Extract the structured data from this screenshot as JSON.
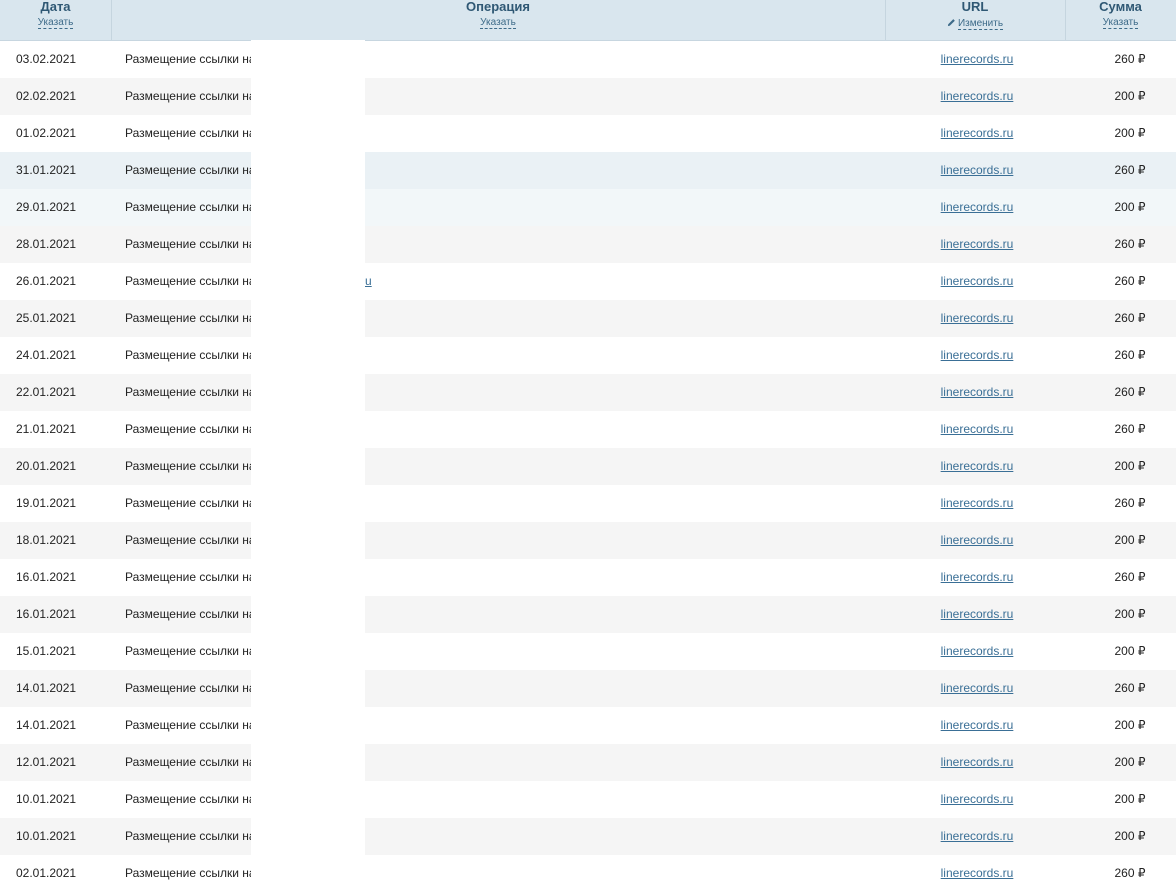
{
  "header": {
    "date": {
      "title": "Дата",
      "sub": "Указать"
    },
    "operation": {
      "title": "Операция",
      "sub": "Указать"
    },
    "url": {
      "title": "URL",
      "sub": "Изменить",
      "icon": "pencil-icon"
    },
    "sum": {
      "title": "Сумма",
      "sub": "Указать"
    }
  },
  "rows": [
    {
      "date": "03.02.2021",
      "op": "Размещение ссылки на",
      "url": "linerecords.ru",
      "sum": "260 ₽"
    },
    {
      "date": "02.02.2021",
      "op": "Размещение ссылки на",
      "url": "linerecords.ru",
      "sum": "200 ₽"
    },
    {
      "date": "01.02.2021",
      "op": "Размещение ссылки на",
      "url": "linerecords.ru",
      "sum": "200 ₽"
    },
    {
      "date": "31.01.2021",
      "op": "Размещение ссылки на",
      "url": "linerecords.ru",
      "sum": "260 ₽"
    },
    {
      "date": "29.01.2021",
      "op": "Размещение ссылки на",
      "url": "linerecords.ru",
      "sum": "200 ₽"
    },
    {
      "date": "28.01.2021",
      "op": "Размещение ссылки на",
      "url": "linerecords.ru",
      "sum": "260 ₽"
    },
    {
      "date": "26.01.2021",
      "op": "Размещение ссылки на",
      "url": "linerecords.ru",
      "sum": "260 ₽",
      "stray": "u"
    },
    {
      "date": "25.01.2021",
      "op": "Размещение ссылки на",
      "url": "linerecords.ru",
      "sum": "260 ₽"
    },
    {
      "date": "24.01.2021",
      "op": "Размещение ссылки на",
      "url": "linerecords.ru",
      "sum": "260 ₽"
    },
    {
      "date": "22.01.2021",
      "op": "Размещение ссылки на",
      "url": "linerecords.ru",
      "sum": "260 ₽"
    },
    {
      "date": "21.01.2021",
      "op": "Размещение ссылки на",
      "url": "linerecords.ru",
      "sum": "260 ₽"
    },
    {
      "date": "20.01.2021",
      "op": "Размещение ссылки на",
      "url": "linerecords.ru",
      "sum": "200 ₽"
    },
    {
      "date": "19.01.2021",
      "op": "Размещение ссылки на",
      "url": "linerecords.ru",
      "sum": "260 ₽"
    },
    {
      "date": "18.01.2021",
      "op": "Размещение ссылки на",
      "url": "linerecords.ru",
      "sum": "200 ₽"
    },
    {
      "date": "16.01.2021",
      "op": "Размещение ссылки на",
      "url": "linerecords.ru",
      "sum": "260 ₽"
    },
    {
      "date": "16.01.2021",
      "op": "Размещение ссылки на",
      "url": "linerecords.ru",
      "sum": "200 ₽"
    },
    {
      "date": "15.01.2021",
      "op": "Размещение ссылки на",
      "url": "linerecords.ru",
      "sum": "200 ₽"
    },
    {
      "date": "14.01.2021",
      "op": "Размещение ссылки на",
      "url": "linerecords.ru",
      "sum": "260 ₽"
    },
    {
      "date": "14.01.2021",
      "op": "Размещение ссылки на",
      "url": "linerecords.ru",
      "sum": "200 ₽"
    },
    {
      "date": "12.01.2021",
      "op": "Размещение ссылки на",
      "url": "linerecords.ru",
      "sum": "200 ₽"
    },
    {
      "date": "10.01.2021",
      "op": "Размещение ссылки на",
      "url": "linerecords.ru",
      "sum": "200 ₽"
    },
    {
      "date": "10.01.2021",
      "op": "Размещение ссылки на",
      "url": "linerecords.ru",
      "sum": "200 ₽"
    },
    {
      "date": "02.01.2021",
      "op": "Размещение ссылки на",
      "url": "linerecords.ru",
      "sum": "260 ₽"
    }
  ]
}
